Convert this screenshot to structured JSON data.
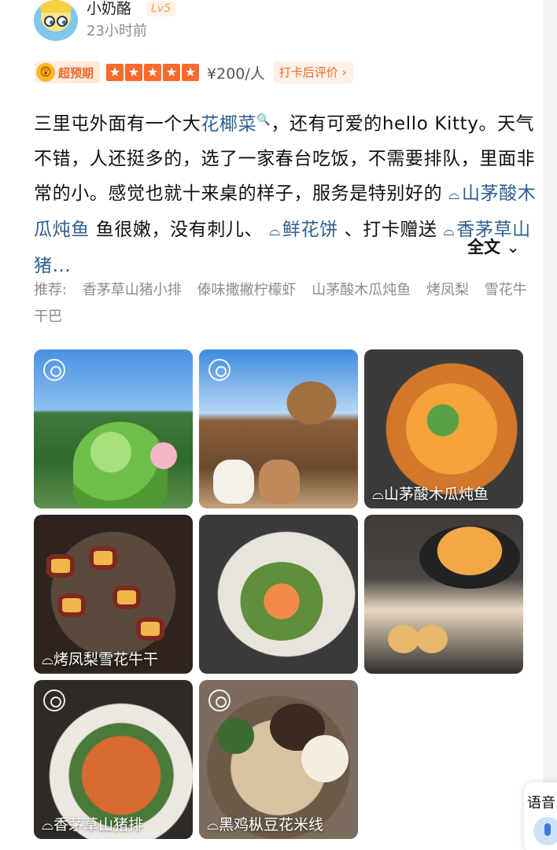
{
  "post": {
    "username": "小奶酪",
    "level": "Lv5",
    "time": "23小时前"
  },
  "rating": {
    "badge": "超预期",
    "price": "¥200/人",
    "checkin_eval": "打卡后评价 ›"
  },
  "content": {
    "p1": "三里屯外面有一个大",
    "link1": "花椰菜",
    "p2": "，还有可爱的hello Kitty。天气不错，人还挺多的，选了一家春台吃饭，不需要排队，里面非常的小。感觉也就十来桌的样子，服务是特别好的 ",
    "tag1": "山茅酸木瓜炖鱼",
    "p3": " 鱼很嫩，没有刺儿、 ",
    "tag2": "鲜花饼",
    "p4": " 、打卡赠送 ",
    "tag3": "香茅草山猪...",
    "fulltext": "全文"
  },
  "recommend": {
    "label": "推荐:",
    "items": [
      "香茅草山猪小排",
      "傣味撒撇柠檬虾",
      "山茅酸木瓜炖鱼",
      "烤凤梨",
      "雪花牛干巴"
    ]
  },
  "photos": {
    "cap3": "山茅酸木瓜炖鱼",
    "cap4": "烤凤梨雪花牛干",
    "cap7": "香茅草山猪排",
    "cap8": "黑鸡枞豆花米线"
  },
  "voice": {
    "label": "语音"
  },
  "colors": {
    "link": "#2f5f8f",
    "accent": "#fb6a2c"
  }
}
